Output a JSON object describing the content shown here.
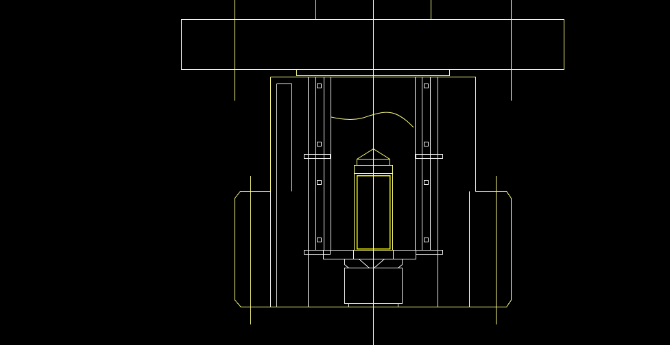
{
  "drawing": {
    "background": "#000000",
    "colors": {
      "yellow_line": "#ffff8a",
      "white_line": "#f2f2f2",
      "bright_yellow": "#ffff00"
    },
    "components": [
      "centerline-vertical",
      "top-plate",
      "top-plate-guide-line-left",
      "top-plate-guide-line-right",
      "top-plate-shoulder",
      "die-body",
      "die-body-centerline-left",
      "die-body-centerline-right",
      "guide-bushing-left",
      "guide-bushing-right",
      "stripper-plate",
      "punch",
      "punch-tip",
      "break-line",
      "bottom-insert"
    ]
  }
}
